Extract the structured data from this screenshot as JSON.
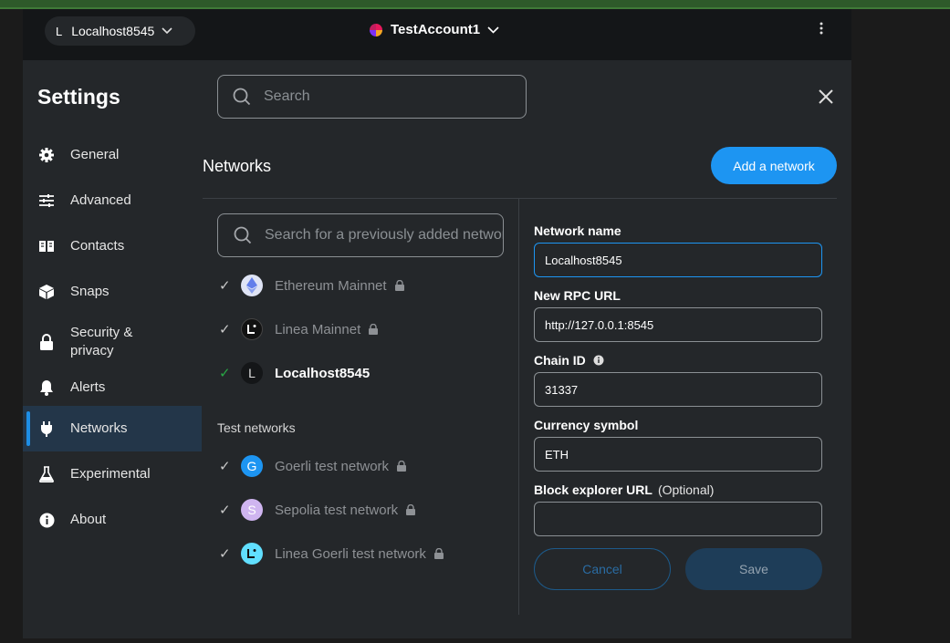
{
  "header": {
    "network_pill": {
      "letter": "L",
      "label": "Localhost8545"
    },
    "account_name": "TestAccount1"
  },
  "settings": {
    "title": "Settings",
    "search_placeholder": "Search"
  },
  "sidebar": {
    "items": [
      {
        "label": "General",
        "icon": "gear-icon",
        "active": false
      },
      {
        "label": "Advanced",
        "icon": "sliders-icon",
        "active": false
      },
      {
        "label": "Contacts",
        "icon": "book-icon",
        "active": false
      },
      {
        "label": "Snaps",
        "icon": "cube-icon",
        "active": false
      },
      {
        "label": "Security & privacy",
        "icon": "lock-icon",
        "active": false
      },
      {
        "label": "Alerts",
        "icon": "bell-icon",
        "active": false
      },
      {
        "label": "Networks",
        "icon": "plug-icon",
        "active": true
      },
      {
        "label": "Experimental",
        "icon": "flask-icon",
        "active": false
      },
      {
        "label": "About",
        "icon": "info-icon",
        "active": false
      }
    ]
  },
  "networks": {
    "section_title": "Networks",
    "add_button": "Add a network",
    "search_placeholder": "Search for a previously added network",
    "main": [
      {
        "name": "Ethereum Mainnet",
        "icon": "ethereum-icon",
        "locked": true,
        "selected": false
      },
      {
        "name": "Linea Mainnet",
        "icon": "linea-icon",
        "locked": true,
        "selected": false
      },
      {
        "name": "Localhost8545",
        "icon": "L",
        "locked": false,
        "selected": true
      }
    ],
    "test_label": "Test networks",
    "test": [
      {
        "name": "Goerli test network",
        "icon": "G",
        "color": "#1d95f2",
        "locked": true
      },
      {
        "name": "Sepolia test network",
        "icon": "S",
        "color": "#cfb5f0",
        "locked": true
      },
      {
        "name": "Linea Goerli test network",
        "icon": "linea-goerli-icon",
        "color": "#61dfff",
        "locked": true
      }
    ]
  },
  "form": {
    "network_name_label": "Network name",
    "network_name_value": "Localhost8545",
    "rpc_label": "New RPC URL",
    "rpc_value": "http://127.0.0.1:8545",
    "chain_id_label": "Chain ID",
    "chain_id_value": "31337",
    "currency_label": "Currency symbol",
    "currency_value": "ETH",
    "explorer_label": "Block explorer URL",
    "explorer_optional": "(Optional)",
    "explorer_value": "",
    "cancel_label": "Cancel",
    "save_label": "Save"
  }
}
